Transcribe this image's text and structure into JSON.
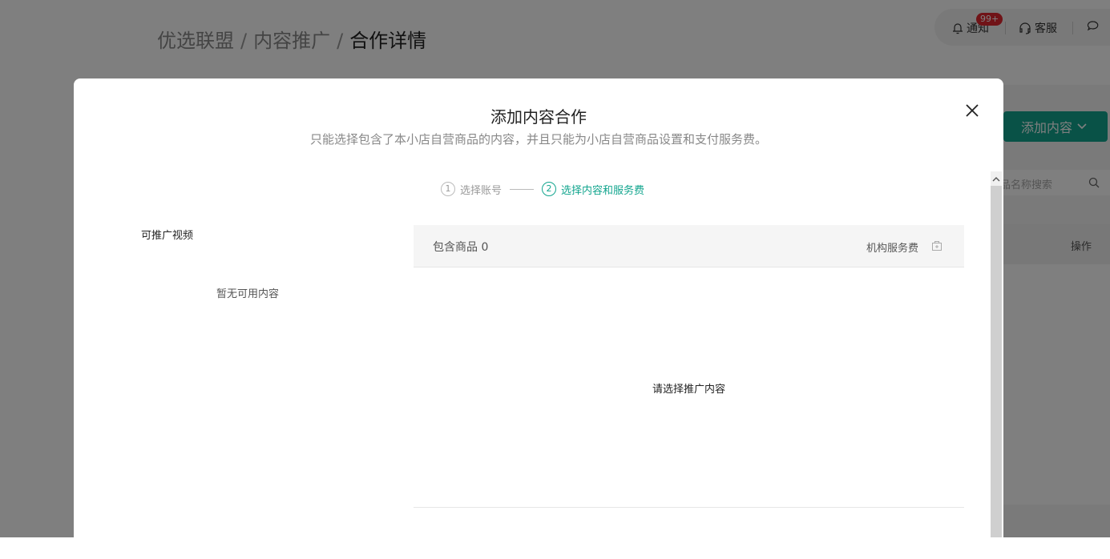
{
  "breadcrumb": {
    "items": [
      "优选联盟",
      "内容推广",
      "合作详情"
    ],
    "separator": "/"
  },
  "topbar": {
    "notify_label": "通知",
    "notify_badge": "99+",
    "service_label": "客服",
    "message_icon": "chat-bubble-icon"
  },
  "background": {
    "add_content_label": "添加内容",
    "search_placeholder": "品名称搜索",
    "table_op_header": "操作"
  },
  "modal": {
    "title": "添加内容合作",
    "subtitle": "只能选择包含了本小店自营商品的内容，并且只能为小店自营商品设置和支付服务费。",
    "steps": [
      {
        "num": "1",
        "label": "选择账号",
        "state": "done"
      },
      {
        "num": "2",
        "label": "选择内容和服务费",
        "state": "active"
      }
    ],
    "left": {
      "title": "可推广视频",
      "empty_text": "暂无可用内容"
    },
    "right": {
      "count_label": "包含商品 0",
      "fee_label": "机构服务费",
      "empty_text": "请选择推广内容"
    }
  },
  "colors": {
    "accent": "#12a58e",
    "badge": "#e0262e",
    "mask": "rgba(0,0,0,0.5)"
  }
}
